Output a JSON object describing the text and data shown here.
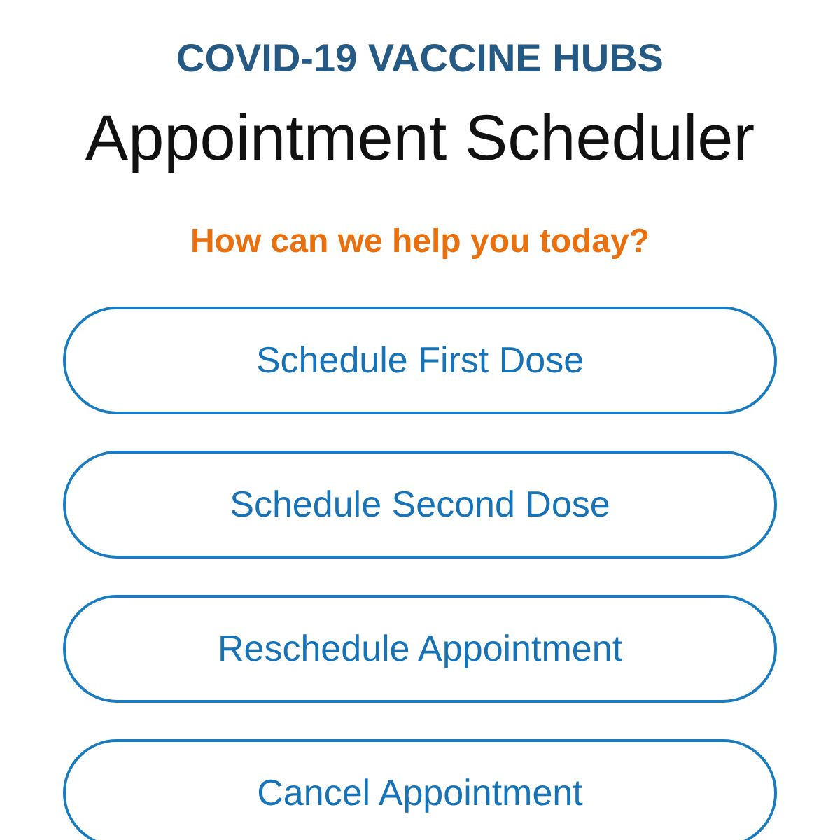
{
  "header": {
    "organization": "COVID-19 VACCINE HUBS",
    "title": "Appointment Scheduler"
  },
  "prompt": "How can we help you today?",
  "actions": [
    {
      "label": "Schedule First Dose"
    },
    {
      "label": "Schedule Second Dose"
    },
    {
      "label": "Reschedule Appointment"
    },
    {
      "label": "Cancel Appointment"
    }
  ]
}
